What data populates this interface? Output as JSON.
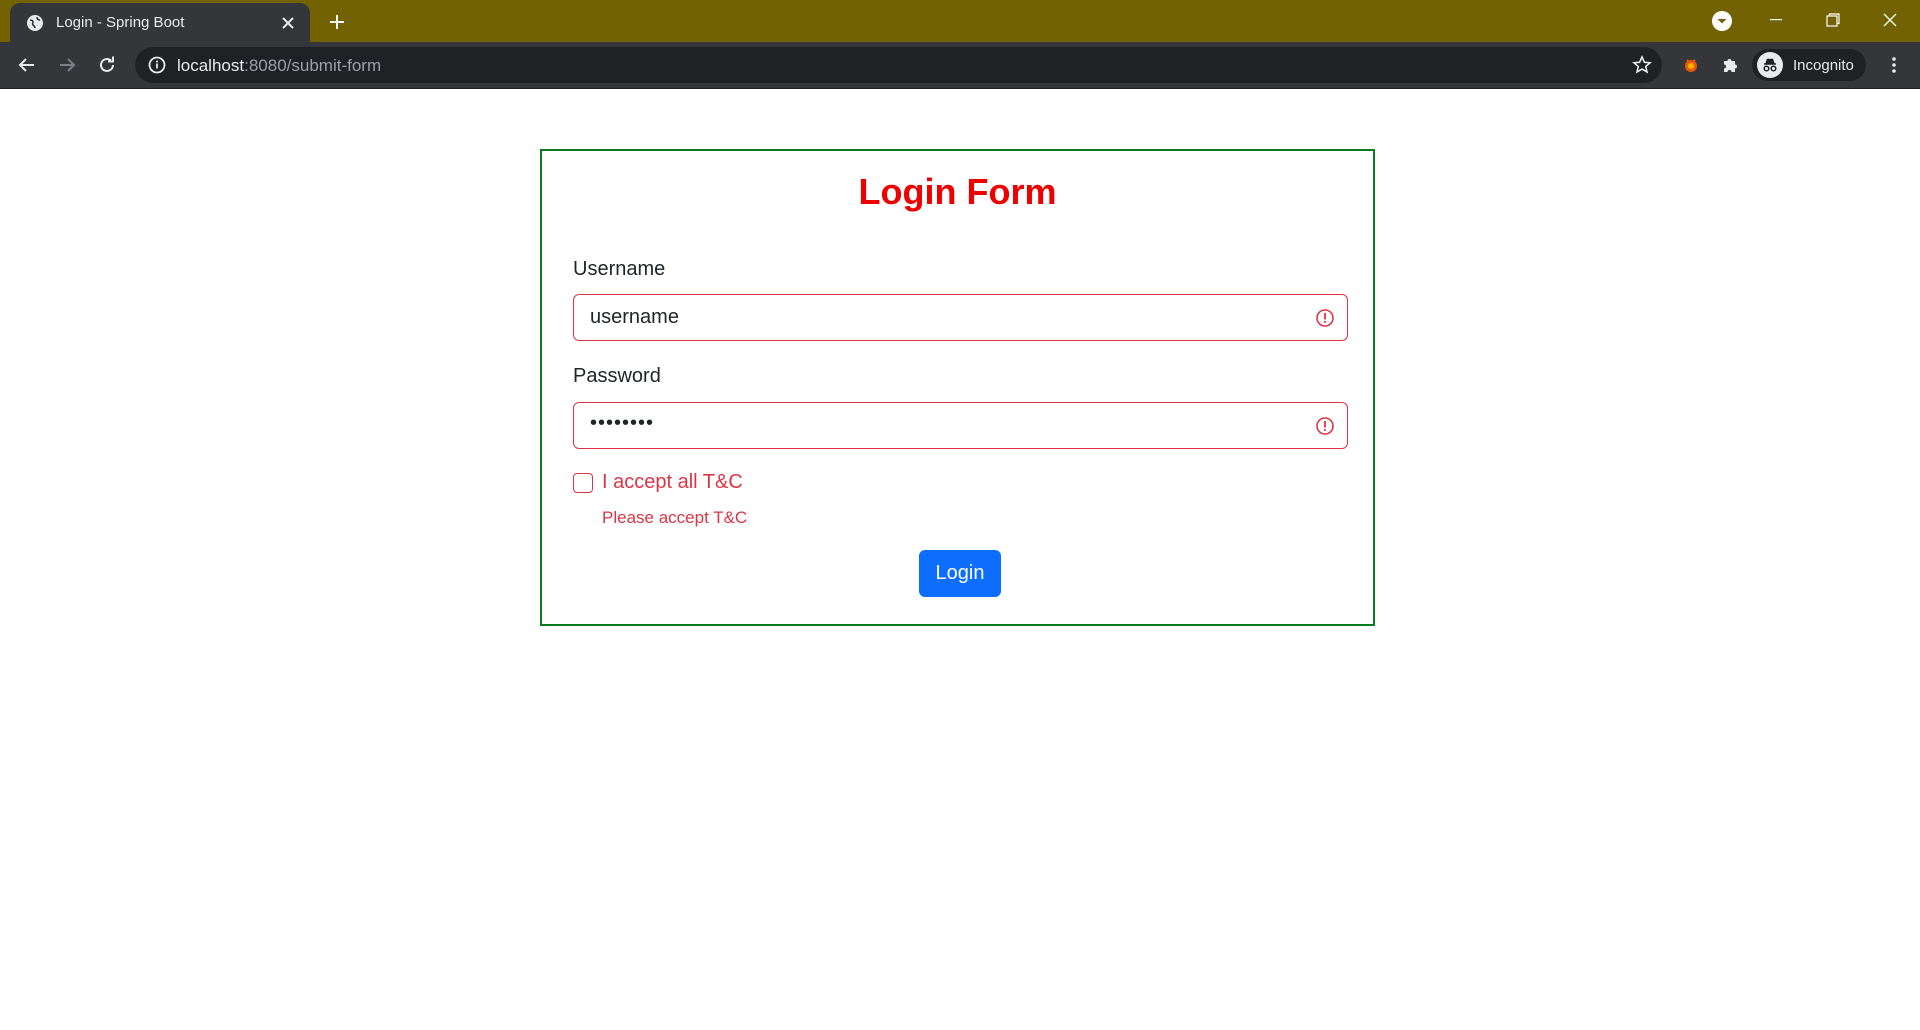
{
  "browser": {
    "tab": {
      "title": "Login - Spring Boot"
    },
    "url": {
      "host": "localhost",
      "path": ":8080/submit-form"
    },
    "profile_label": "Incognito",
    "icons": {
      "tab_favicon": "globe-icon",
      "tab_close": "close-icon",
      "new_tab": "plus-icon",
      "tab_search": "chevron-down-icon",
      "minimize": "minimize-icon",
      "restore": "restore-icon",
      "close_window": "close-icon",
      "back": "arrow-left-icon",
      "forward": "arrow-right-icon",
      "reload": "reload-icon",
      "site_info": "info-icon",
      "bookmark": "star-icon",
      "extension": "extension-icon",
      "extensions_menu": "puzzle-icon",
      "incognito": "incognito-icon",
      "menu": "kebab-menu-icon"
    },
    "colors": {
      "frame": "#736202",
      "toolbar": "#35363a",
      "omnibox": "#202124"
    }
  },
  "page": {
    "title": "Login Form",
    "username": {
      "label": "Username",
      "value": "username"
    },
    "password": {
      "label": "Password",
      "value": "••••••••"
    },
    "terms": {
      "label": "I accept all T&C",
      "checked": false,
      "error": "Please accept T&C"
    },
    "submit_label": "Login",
    "colors": {
      "title": "#ee0000",
      "border": "#0a7a1e",
      "error": "#dc3545",
      "primary": "#0d6efd"
    }
  }
}
